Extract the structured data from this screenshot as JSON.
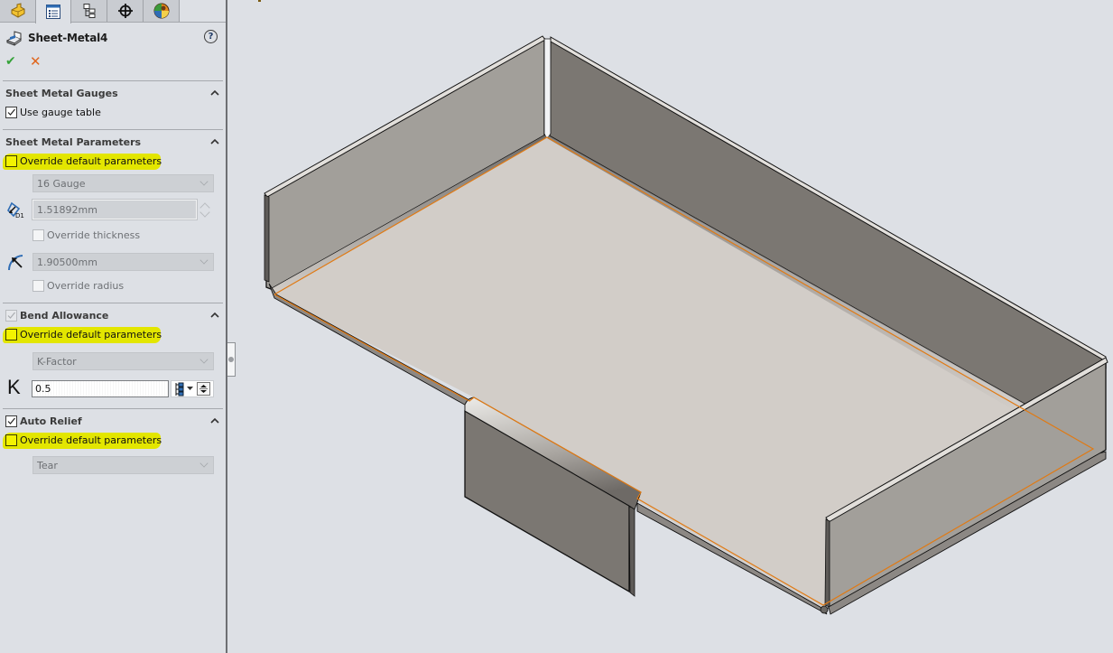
{
  "panel": {
    "tabs": [
      {
        "name": "FeatureManager design tree",
        "icon": "part-icon",
        "active": false
      },
      {
        "name": "PropertyManager",
        "icon": "property-manager-icon",
        "active": true
      },
      {
        "name": "ConfigurationManager",
        "icon": "configuration-manager-icon",
        "active": false
      },
      {
        "name": "DimXpertManager",
        "icon": "crosshair-icon",
        "active": false
      },
      {
        "name": "DisplayManager",
        "icon": "display-manager-icon",
        "active": false
      }
    ],
    "title": "Sheet-Metal4",
    "help_label": "?",
    "ok_label": "✔",
    "cancel_label": "✕",
    "sections": {
      "gauges": {
        "title": "Sheet Metal Gauges",
        "use_gauge_table": {
          "label": "Use gauge table",
          "checked": true
        }
      },
      "parameters": {
        "title": "Sheet Metal Parameters",
        "override": {
          "label": "Override default parameters",
          "checked": false,
          "highlighted": true
        },
        "gauge_select": {
          "value": "16 Gauge",
          "enabled": false
        },
        "thickness": {
          "value": "1.51892mm",
          "enabled": false,
          "icon_label": "D1"
        },
        "override_thickness": {
          "label": "Override thickness",
          "checked": false,
          "enabled": false
        },
        "radius_select": {
          "value": "1.90500mm",
          "enabled": false
        },
        "override_radius": {
          "label": "Override radius",
          "checked": false,
          "enabled": false
        }
      },
      "bend_allowance": {
        "title": "Bend Allowance",
        "checked": true,
        "enabled": false,
        "override": {
          "label": "Override default parameters",
          "checked": false,
          "highlighted": true
        },
        "type_select": {
          "value": "K-Factor",
          "enabled": false
        },
        "k_label": "K",
        "k_value": "0.5"
      },
      "auto_relief": {
        "title": "Auto Relief",
        "checked": true,
        "override": {
          "label": "Override default parameters",
          "checked": false,
          "highlighted": true
        },
        "type_select": {
          "value": "Tear",
          "enabled": false
        }
      }
    }
  },
  "colors": {
    "background": "#dde0e5",
    "highlight_yellow": "#e3e600",
    "ok_green": "#36a33a",
    "cancel_orange": "#e0661d",
    "edge_orange": "#e07a14",
    "wall_light": "#a29f9a",
    "wall_dark": "#7b7772",
    "base_face": "#d2cdc8"
  },
  "viewport": {
    "model": "sheet-metal tray with four flanges and a tab flange"
  }
}
